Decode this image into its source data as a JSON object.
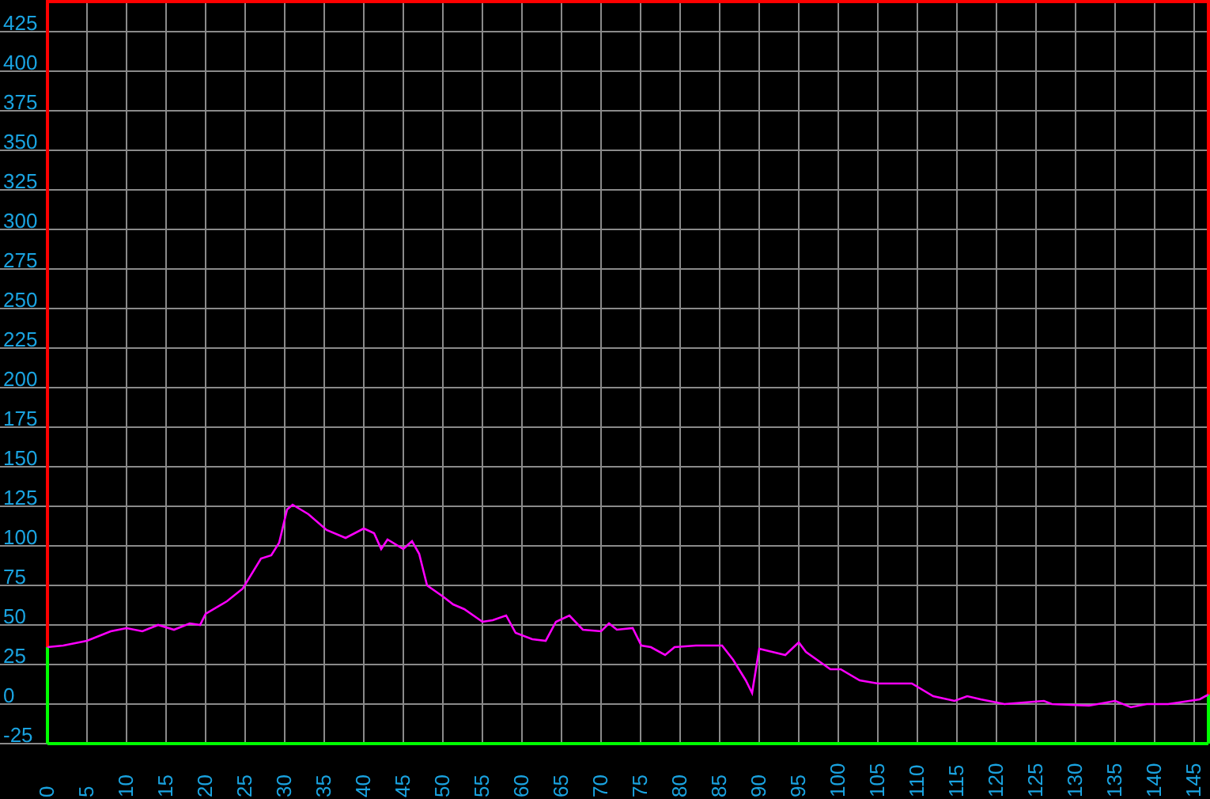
{
  "chart": {
    "chart_data": {
      "type": "line",
      "x": [
        0,
        2,
        5,
        8,
        10,
        12,
        14,
        16,
        18,
        19.3,
        20,
        22.7,
        24.7,
        27,
        28.3,
        29.3,
        30.3,
        31,
        33,
        35.3,
        37.7,
        40,
        41.3,
        42.2,
        43,
        45,
        46.1,
        47,
        48,
        50,
        51.3,
        52.7,
        55,
        56.3,
        58,
        59.2,
        61.3,
        63,
        64.3,
        66,
        67.7,
        70,
        71,
        72,
        74,
        75.1,
        76.3,
        78.1,
        79.3,
        82,
        85.3,
        86.7,
        88.3,
        89.1,
        90,
        93.3,
        95,
        95.9,
        97.3,
        99,
        100.3,
        102.7,
        105,
        107.7,
        109.3,
        112,
        114.7,
        116.3,
        118,
        121,
        126,
        127,
        131.7,
        135,
        137,
        139,
        141.7,
        145.7,
        146.8
      ],
      "values": [
        36,
        37,
        40,
        46,
        48,
        46,
        50,
        47,
        51,
        50,
        57,
        65,
        73,
        92,
        94,
        102,
        123,
        126,
        120,
        110,
        105,
        111,
        108,
        98,
        104,
        98,
        103,
        95,
        75,
        68,
        63,
        60,
        52,
        53,
        56,
        45,
        41,
        40,
        52,
        56,
        47,
        46,
        51,
        47,
        48,
        37,
        36,
        31,
        36,
        37,
        37,
        28,
        15,
        7,
        35,
        31,
        39,
        33,
        28,
        22,
        22,
        15,
        13,
        13,
        13,
        5,
        2,
        5,
        3,
        0,
        2,
        0,
        -1,
        2,
        -2,
        0,
        0,
        3,
        6
      ],
      "grid": true,
      "xlim": [
        0,
        146.8
      ],
      "ylim": [
        -25,
        445
      ],
      "xticks": [
        0,
        5,
        10,
        15,
        20,
        25,
        30,
        35,
        40,
        45,
        50,
        55,
        60,
        65,
        70,
        75,
        80,
        85,
        90,
        95,
        100,
        105,
        110,
        115,
        120,
        125,
        130,
        135,
        140,
        145
      ],
      "yticks": [
        -25,
        0,
        25,
        50,
        75,
        100,
        125,
        150,
        175,
        200,
        225,
        250,
        275,
        300,
        325,
        350,
        375,
        400,
        425
      ]
    }
  }
}
